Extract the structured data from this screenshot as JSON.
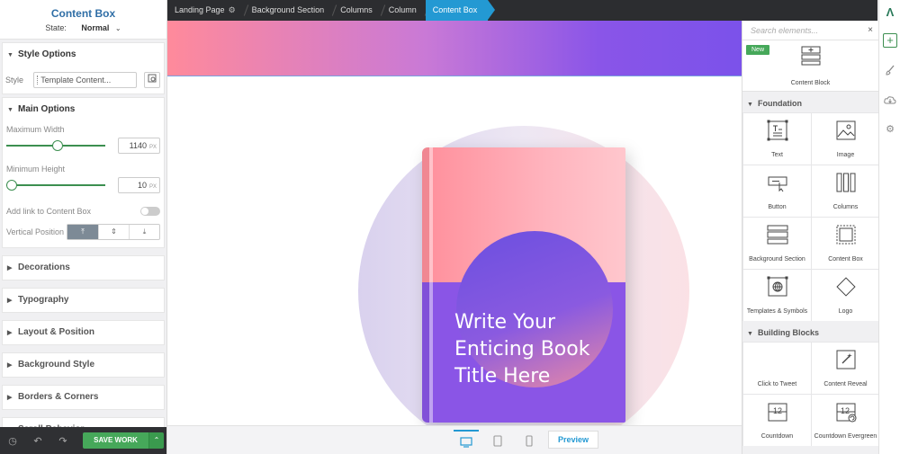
{
  "left_panel": {
    "title": "Content Box",
    "state_label": "State:",
    "state_value": "Normal",
    "style_options": {
      "header": "Style Options",
      "style_label": "Style",
      "style_value": "Template Content..."
    },
    "main_options": {
      "header": "Main Options",
      "max_width_label": "Maximum Width",
      "max_width_value": "1140",
      "max_width_unit": "PX",
      "max_width_fraction": 0.5,
      "min_height_label": "Minimum Height",
      "min_height_value": "10",
      "min_height_unit": "PX",
      "min_height_fraction": 0.0,
      "link_label": "Add link to Content Box",
      "vertical_position_label": "Vertical Position"
    },
    "collapsed_sections": [
      "Decorations",
      "Typography",
      "Layout & Position",
      "Background Style",
      "Borders & Corners",
      "Scroll Behavior"
    ],
    "save_label": "SAVE WORK"
  },
  "breadcrumbs": [
    "Landing Page",
    "Background Section",
    "Columns",
    "Column",
    "Content Box"
  ],
  "canvas": {
    "book_title_lines": [
      "Write Your",
      "Enticing Book",
      "Title Here"
    ]
  },
  "device_bar": {
    "preview_label": "Preview"
  },
  "right_panel": {
    "search_placeholder": "Search elements...",
    "new_badge": "New",
    "content_block_label": "Content Block",
    "foundation_header": "Foundation",
    "foundation_items": [
      "Text",
      "Image",
      "Button",
      "Columns",
      "Background Section",
      "Content Box",
      "Templates & Symbols",
      "Logo"
    ],
    "building_blocks_header": "Building Blocks",
    "building_blocks_items": [
      "Click to Tweet",
      "Content Reveal",
      "Countdown",
      "Countdown Evergreen"
    ]
  },
  "colors": {
    "accent_blue": "#2399d3",
    "accent_green": "#46a85a",
    "title_blue": "#2f6ea6",
    "book_purple": "#8a55e6",
    "book_pink": "#ff8f9b"
  }
}
